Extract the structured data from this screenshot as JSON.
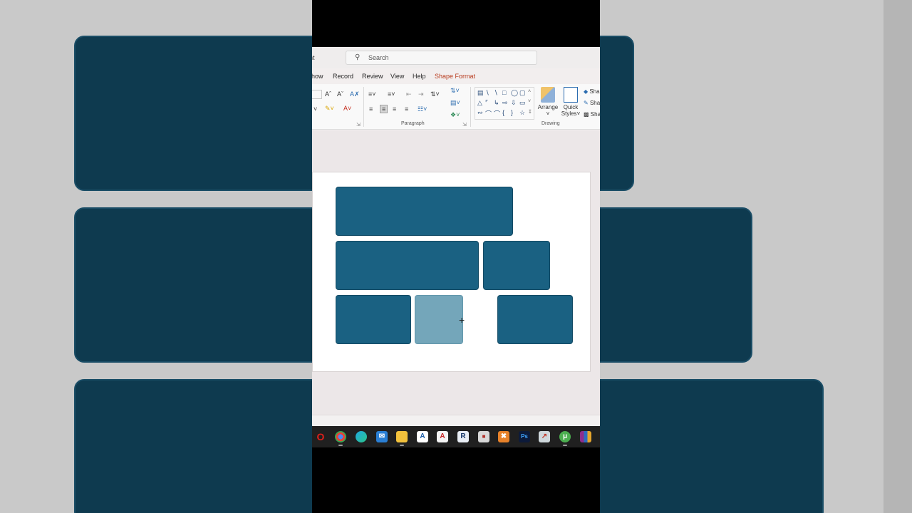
{
  "titlebar": {
    "app_name_fragment": "nt",
    "search_icon": "search-icon",
    "search_placeholder": "Search"
  },
  "tabs": [
    {
      "label": "how"
    },
    {
      "label": "Record"
    },
    {
      "label": "Review"
    },
    {
      "label": "View"
    },
    {
      "label": "Help"
    },
    {
      "label": "Shape Format"
    }
  ],
  "ribbon": {
    "groups": [
      {
        "label": "Paragraph"
      },
      {
        "label": "Drawing"
      }
    ],
    "buttons": {
      "arrange": "Arrange",
      "quick_styles_line1": "Quick",
      "quick_styles_line2": "Styles",
      "shape_fill": "Sha",
      "shape_outline": "Sha",
      "shape_effects": "Sha"
    }
  },
  "slide": {
    "blocks": [
      {
        "style": "dark",
        "color": "#1a6182"
      },
      {
        "style": "dark",
        "color": "#1a6182"
      },
      {
        "style": "dark",
        "color": "#1a6182"
      },
      {
        "style": "dark",
        "color": "#1a6182"
      },
      {
        "style": "selected-light",
        "color": "#74a6ba"
      },
      {
        "style": "dark",
        "color": "#1a6182"
      }
    ]
  },
  "taskbar": {
    "apps": [
      "opera-icon",
      "chrome-icon",
      "edge-icon",
      "mail-icon",
      "file-explorer-icon",
      "a-app-icon",
      "acrobat-icon",
      "r-app-icon",
      "tool-icon",
      "x-app-icon",
      "photoshop-icon",
      "image-app-icon",
      "utorrent-icon",
      "winrar-icon"
    ]
  }
}
